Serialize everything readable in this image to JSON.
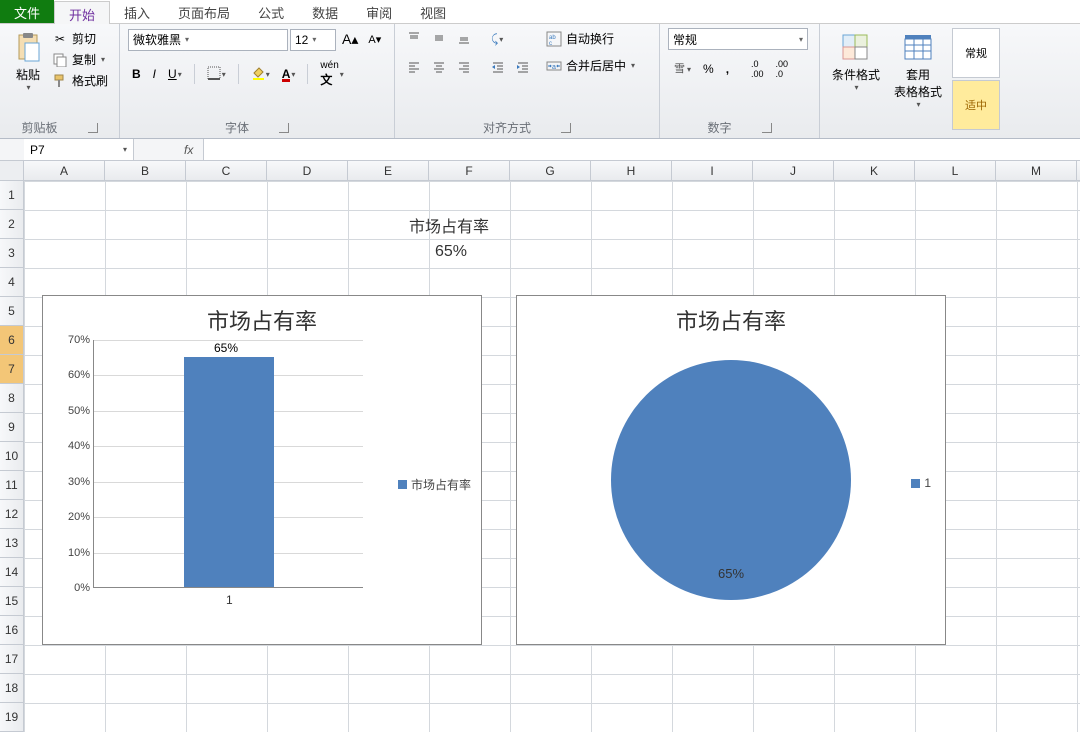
{
  "menubar": {
    "file": "文件",
    "tabs": [
      "开始",
      "插入",
      "页面布局",
      "公式",
      "数据",
      "审阅",
      "视图"
    ],
    "active_index": 0
  },
  "ribbon": {
    "clipboard": {
      "paste": "粘贴",
      "cut": "剪切",
      "copy": "复制",
      "format_painter": "格式刷",
      "group_label": "剪贴板"
    },
    "font": {
      "font_name": "微软雅黑",
      "font_size": "12",
      "bold": "B",
      "italic": "I",
      "underline": "U",
      "group_label": "字体"
    },
    "alignment": {
      "wrap": "自动换行",
      "merge": "合并后居中",
      "group_label": "对齐方式"
    },
    "number": {
      "format": "常规",
      "percent": "%",
      "comma": ",",
      "group_label": "数字"
    },
    "styles": {
      "cond_fmt": "条件格式",
      "table_fmt": "套用\n表格格式",
      "normal": "常规",
      "good": "适中"
    }
  },
  "name_box": "P7",
  "formula_bar": "",
  "columns": [
    "A",
    "B",
    "C",
    "D",
    "E",
    "F",
    "G",
    "H",
    "I",
    "J",
    "K",
    "L",
    "M"
  ],
  "row_count": 19,
  "selected_rows": [
    6,
    7
  ],
  "cell_F2": "市场占有率",
  "cell_F3": "65%",
  "chart_data": [
    {
      "type": "bar",
      "title": "市场占有率",
      "categories": [
        "1"
      ],
      "series": [
        {
          "name": "市场占有率",
          "values": [
            65
          ]
        }
      ],
      "ylabel": "",
      "ylim": [
        0,
        70
      ],
      "y_ticks": [
        0,
        10,
        20,
        30,
        40,
        50,
        60,
        70
      ],
      "y_format": "percent",
      "data_labels": [
        "65%"
      ],
      "legend": "市场占有率"
    },
    {
      "type": "pie",
      "title": "市场占有率",
      "categories": [
        "1"
      ],
      "values": [
        65
      ],
      "data_labels": [
        "65%"
      ],
      "legend": "1",
      "color": "#4f81bd"
    }
  ]
}
